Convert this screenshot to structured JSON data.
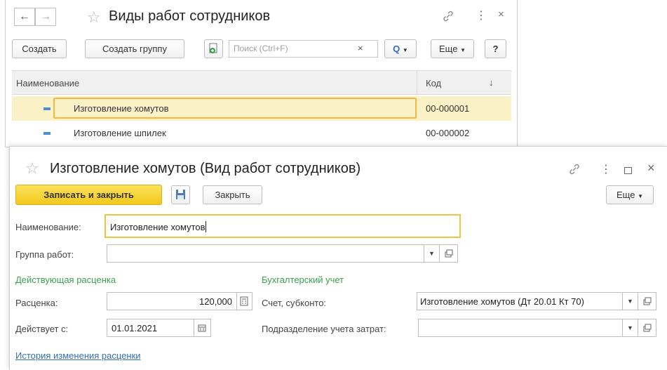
{
  "list_window": {
    "title": "Виды работ сотрудников",
    "toolbar": {
      "create_label": "Создать",
      "create_group_label": "Создать группу",
      "search_placeholder": "Поиск (Ctrl+F)",
      "search_clear": "×",
      "more_label": "Еще",
      "help_label": "?"
    },
    "columns": {
      "name": "Наименование",
      "code": "Код",
      "sort": "↓"
    },
    "rows": [
      {
        "name": "Изготовление хомутов",
        "code": "00-000001"
      },
      {
        "name": "Изготовление шпилек",
        "code": "00-000002"
      }
    ]
  },
  "form_window": {
    "title": "Изготовление хомутов (Вид работ сотрудников)",
    "toolbar": {
      "save_close_label": "Записать и закрыть",
      "close_label": "Закрыть",
      "more_label": "Еще"
    },
    "fields": {
      "name_label": "Наименование:",
      "name_value": "Изготовление хомутов",
      "group_label": "Группа работ:",
      "group_value": "",
      "rate_label": "Расценка:",
      "rate_value": "120,000",
      "valid_from_label": "Действует с:",
      "valid_from_value": "01.01.2021",
      "account_label": "Счет, субконто:",
      "account_value": "Изготовление хомутов (Дт 20.01 Кт 70)",
      "cost_dept_label": "Подразделение учета затрат:",
      "cost_dept_value": ""
    },
    "sections": {
      "current_rate": "Действующая расценка",
      "accounting": "Бухгалтерский учет"
    },
    "history_link": "История изменения расценки"
  },
  "colors": {
    "accent_yellow": "#f5cf2c",
    "selection_row": "#fbf1c7",
    "link_blue": "#2f6fb8",
    "section_green": "#3aa14c"
  }
}
